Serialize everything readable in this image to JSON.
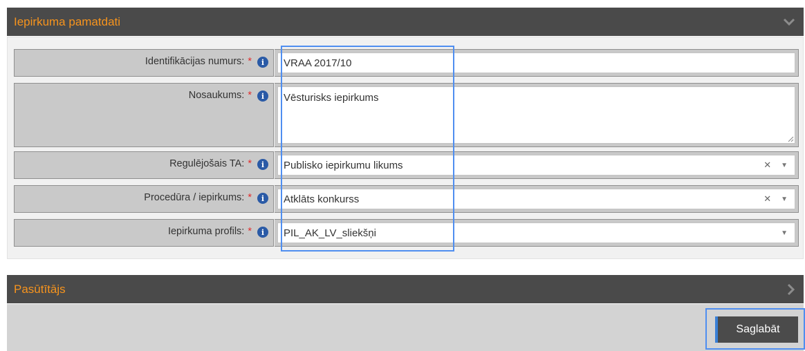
{
  "panel_main": {
    "title": "Iepirkuma pamatdati",
    "fields": [
      {
        "label": "Identifikācijas numurs:",
        "required": "*",
        "value": "VRAA 2017/10"
      },
      {
        "label": "Nosaukums:",
        "required": "*",
        "value": "Vēsturisks iepirkums"
      },
      {
        "label": "Regulējošais TA:",
        "required": "*",
        "value": "Publisko iepirkumu likums"
      },
      {
        "label": "Procedūra / iepirkums:",
        "required": "*",
        "value": "Atklāts konkurss"
      },
      {
        "label": "Iepirkuma profils:",
        "required": "*",
        "value": "PIL_AK_LV_sliekšņi"
      }
    ]
  },
  "panel_customer": {
    "title": "Pasūtītājs"
  },
  "footer": {
    "save_label": "Saglabāt"
  },
  "icons": {
    "info": "info-icon",
    "expand_main": "chevron-down-icon",
    "expand_customer": "chevron-right-icon",
    "clear": "clear-icon",
    "dropdown": "dropdown-arrow-icon"
  },
  "colors": {
    "header_bg": "#4a4a4a",
    "header_text": "#f7941d",
    "required": "#e22d2d",
    "info_icon": "#2a5aa6",
    "highlight": "#4f8ef0",
    "save_button_bg": "#4b4b4b"
  }
}
